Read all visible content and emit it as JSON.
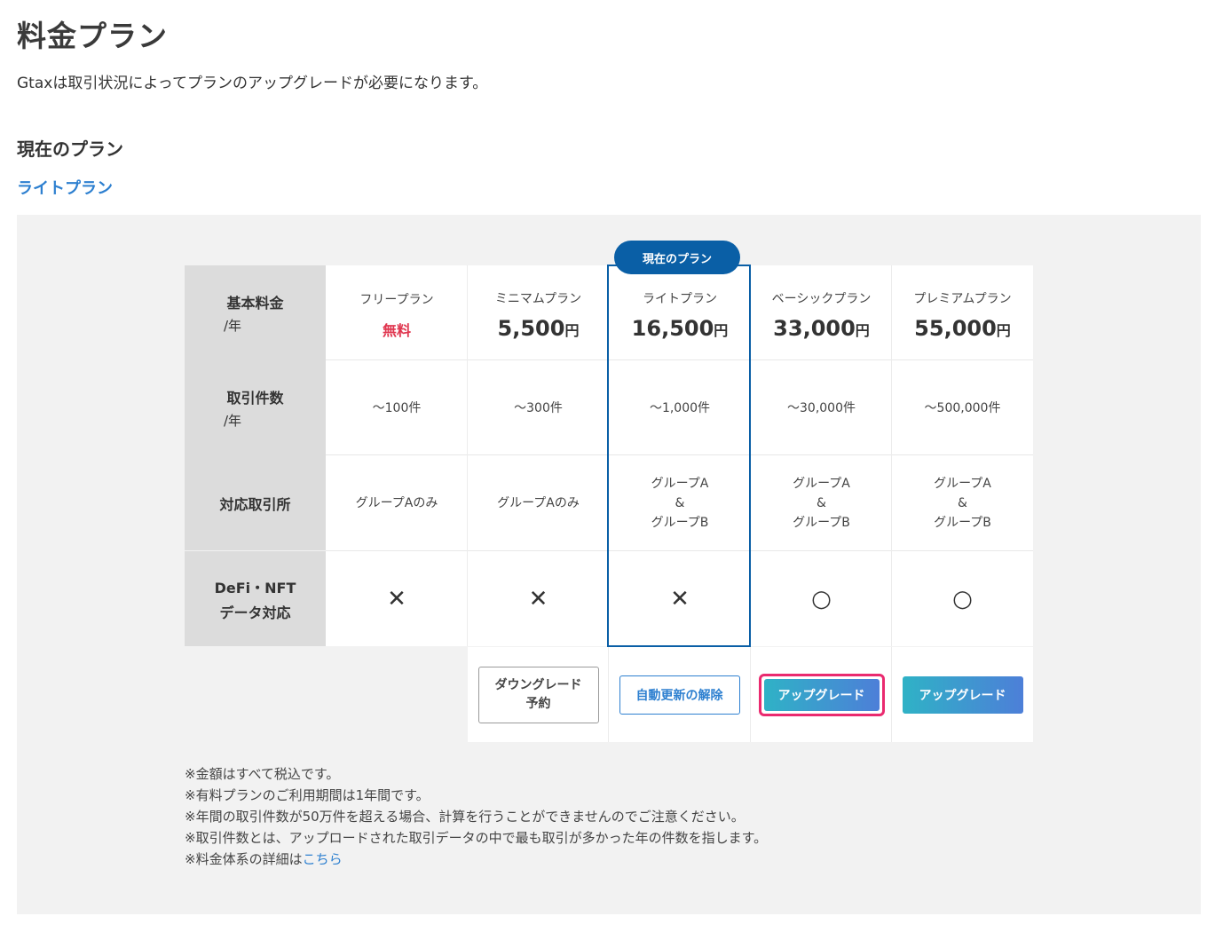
{
  "header": {
    "title": "料金プラン",
    "description": "Gtaxは取引状況によってプランのアップグレードが必要になります。"
  },
  "current": {
    "heading": "現在のプラン",
    "plan_name": "ライトプラン",
    "badge": "現在のプラン"
  },
  "row_labels": {
    "fee": "基本料金",
    "fee_unit": "/年",
    "count": "取引件数",
    "count_unit": "/年",
    "exchange": "対応取引所",
    "defi_line1": "DeFi・NFT",
    "defi_line2": "データ対応"
  },
  "plans": [
    {
      "name": "フリープラン",
      "price": "無料",
      "yen": "",
      "count": "〜100件",
      "ex1": "グループAのみ",
      "ex2": "",
      "ex3": "",
      "defi": "✕"
    },
    {
      "name": "ミニマムプラン",
      "price": "5,500",
      "yen": "円",
      "count": "〜300件",
      "ex1": "グループAのみ",
      "ex2": "",
      "ex3": "",
      "defi": "✕"
    },
    {
      "name": "ライトプラン",
      "price": "16,500",
      "yen": "円",
      "count": "〜1,000件",
      "ex1": "グループA",
      "ex2": "&",
      "ex3": "グループB",
      "defi": "✕"
    },
    {
      "name": "ベーシックプラン",
      "price": "33,000",
      "yen": "円",
      "count": "〜30,000件",
      "ex1": "グループA",
      "ex2": "&",
      "ex3": "グループB",
      "defi": "○"
    },
    {
      "name": "プレミアムプラン",
      "price": "55,000",
      "yen": "円",
      "count": "〜500,000件",
      "ex1": "グループA",
      "ex2": "&",
      "ex3": "グループB",
      "defi": "○"
    }
  ],
  "buttons": {
    "downgrade_line1": "ダウングレード",
    "downgrade_line2": "予約",
    "cancel_renewal": "自動更新の解除",
    "upgrade_basic": "アップグレード",
    "upgrade_premium": "アップグレード"
  },
  "notes": {
    "line1": "※金額はすべて税込です。",
    "line2": "※有料プランのご利用期間は1年間です。",
    "line3": "※年間の取引件数が50万件を超える場合、計算を行うことができませんのでご注意ください。",
    "line4": "※取引件数とは、アップロードされた取引データの中で最も取引が多かった年の件数を指します。",
    "line5_prefix": "※料金体系の詳細は",
    "line5_link": "こちら"
  },
  "colors": {
    "accent_blue": "#0a5fa6",
    "link_blue": "#2e80d0",
    "free_red": "#e0364f",
    "focus_pink": "#ea2a6f",
    "upgrade_gradient_start": "#2fb2c6",
    "upgrade_gradient_end": "#4d7fd8"
  }
}
